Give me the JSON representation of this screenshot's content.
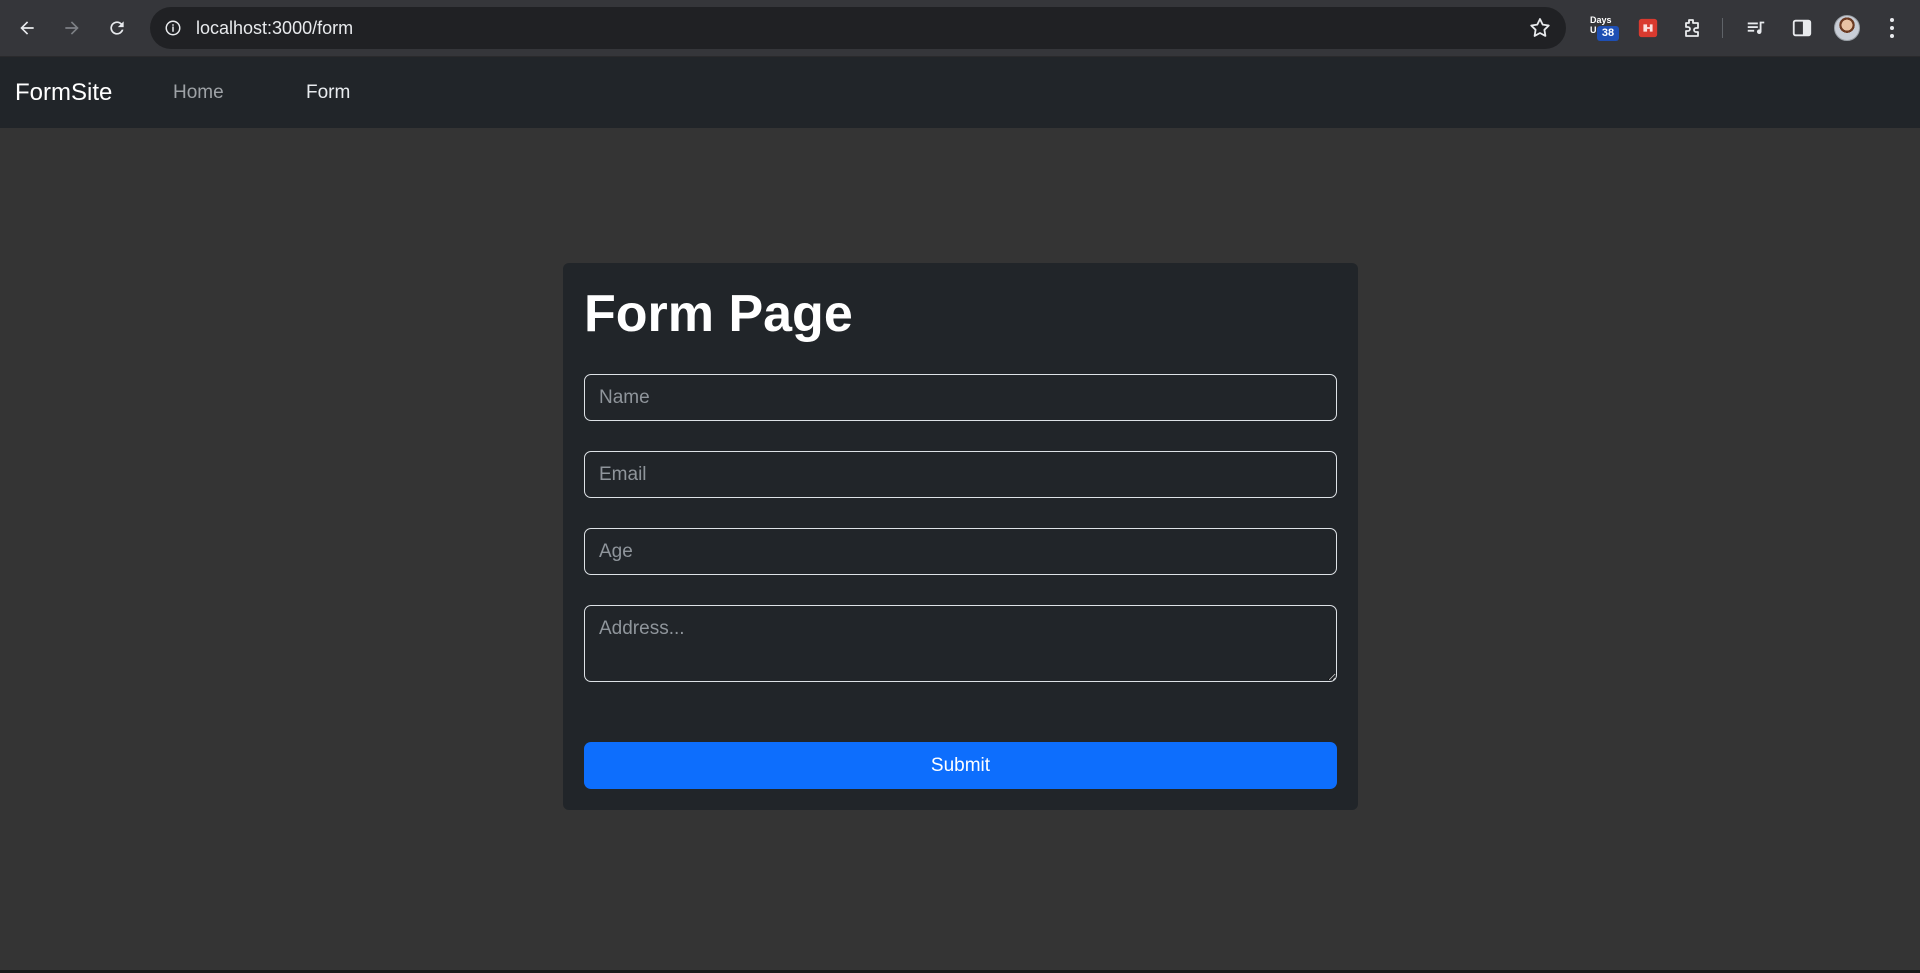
{
  "browser": {
    "url": "localhost:3000/form",
    "extensions": {
      "days_label_top": "Days",
      "days_label_bottom": "U",
      "days_badge": "38"
    }
  },
  "navbar": {
    "brand": "FormSite",
    "links": [
      {
        "label": "Home"
      },
      {
        "label": "Form"
      }
    ]
  },
  "form": {
    "title": "Form Page",
    "fields": {
      "name": {
        "placeholder": "Name",
        "value": ""
      },
      "email": {
        "placeholder": "Email",
        "value": ""
      },
      "age": {
        "placeholder": "Age",
        "value": ""
      },
      "address": {
        "placeholder": "Address...",
        "value": ""
      }
    },
    "submit_label": "Submit"
  },
  "colors": {
    "page_bg": "#343434",
    "navbar_bg": "#212529",
    "card_bg": "#212529",
    "primary": "#0d6efd"
  },
  "icons": [
    "back-icon",
    "forward-icon",
    "reload-icon",
    "site-info-icon",
    "bookmark-star-icon",
    "puzzle-extension-icon",
    "media-controls-icon",
    "side-panel-icon",
    "more-menu-icon"
  ]
}
